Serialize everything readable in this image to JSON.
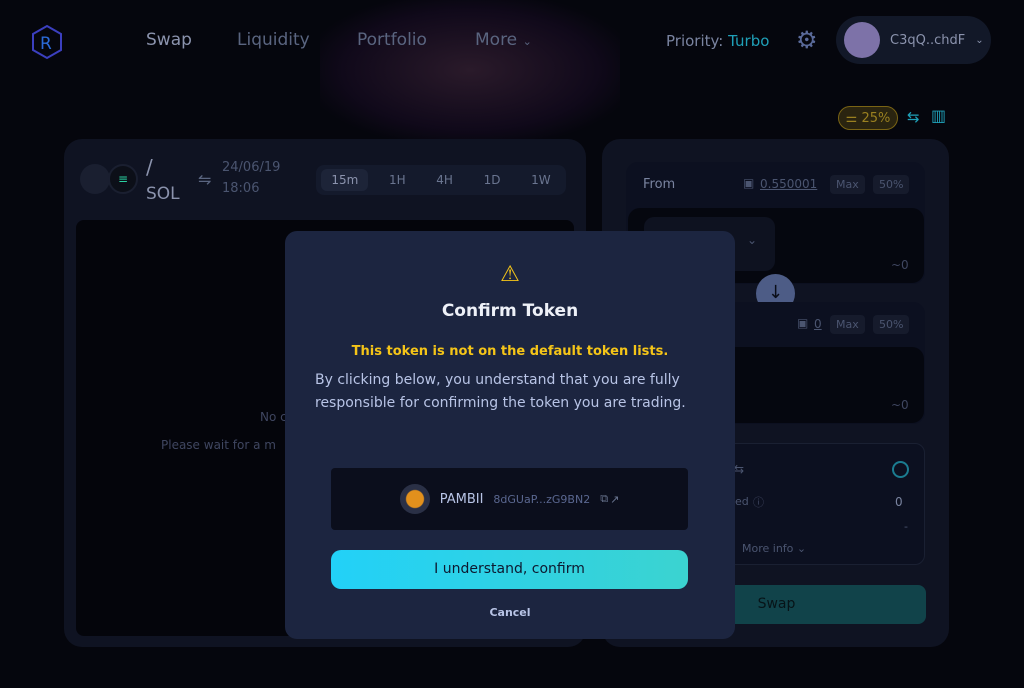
{
  "nav": {
    "items": [
      "Swap",
      "Liquidity",
      "Portfolio",
      "More"
    ],
    "priority_label": "Priority:",
    "priority_value": "Turbo",
    "wallet": "C3qQ..chdF"
  },
  "toolbar": {
    "slippage": "25%"
  },
  "chart": {
    "pair_slash": "/",
    "pair_quote": "SOL",
    "date": "24/06/19",
    "time": "18:06",
    "timeframes": [
      "15m",
      "1H",
      "4H",
      "1D",
      "1W"
    ],
    "selected_timeframe": "15m",
    "empty_line1": "No c",
    "empty_line2": "Please wait for a m"
  },
  "swap": {
    "from_label": "From",
    "from_balance": "0.550001",
    "max": "Max",
    "half": "50%",
    "from_value": "~0",
    "to_balance": "0",
    "to_value": "~0",
    "info_fragment": "ed",
    "info_value": "0",
    "info_dash": "-",
    "more_info": "More info",
    "swap_button": "Swap"
  },
  "modal": {
    "title": "Confirm Token",
    "warning": "This token is not on the default token lists.",
    "body": "By clicking below, you understand that you are fully responsible for confirming the token you are trading.",
    "token_symbol": "PAMBII",
    "token_address": "8dGUaP...zG9BN2",
    "confirm": "I understand, confirm",
    "cancel": "Cancel"
  },
  "colors": {
    "accent": "#22d1f8",
    "warning": "#f5c518",
    "turbo": "#1fa0b8"
  }
}
